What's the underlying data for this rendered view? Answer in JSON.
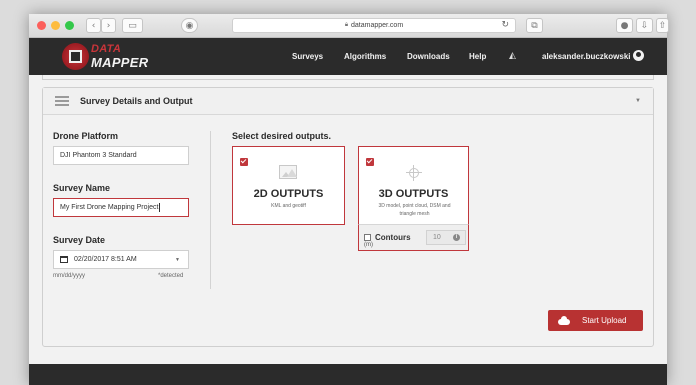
{
  "browser": {
    "url": "datamapper.com",
    "back_icon": "chevron-left",
    "forward_icon": "chevron-right",
    "sidebar_icon": "sidebar-toggle",
    "shield_icon": "shield",
    "reload_icon": "reload",
    "lights": [
      "#fc605c",
      "#fdbc40",
      "#34c84a"
    ]
  },
  "header": {
    "brand_line1": "DATA",
    "brand_line2": "MAPPER",
    "nav": [
      "Surveys",
      "Algorithms",
      "Downloads",
      "Help"
    ],
    "user": "aleksander.buczkowski"
  },
  "panel": {
    "title": "Survey Details and Output"
  },
  "form": {
    "drone_label": "Drone Platform",
    "drone_value": "DJI Phantom 3 Standard",
    "name_label": "Survey Name",
    "name_value": "My First Drone Mapping Project",
    "date_label": "Survey Date",
    "date_value": "02/20/2017 8:51 AM",
    "date_format": "mm/dd/yyyy",
    "date_detected": "*detected"
  },
  "outputs": {
    "heading": "Select desired outputs.",
    "card2d": {
      "title": "2D OUTPUTS",
      "subtitle": "KML and geotiff",
      "checked": true
    },
    "card3d": {
      "title": "3D OUTPUTS",
      "subtitle_line1": "3D model, point cloud, DSM and",
      "subtitle_line2": "triangle mesh",
      "checked": true
    },
    "contours": {
      "label": "Contours",
      "unit": "(m)",
      "value": "10",
      "info": "i",
      "checked": false
    }
  },
  "actions": {
    "upload_label": "Start Upload"
  },
  "colors": {
    "accent": "#c0373c",
    "header_bg": "#2b2b2b"
  }
}
